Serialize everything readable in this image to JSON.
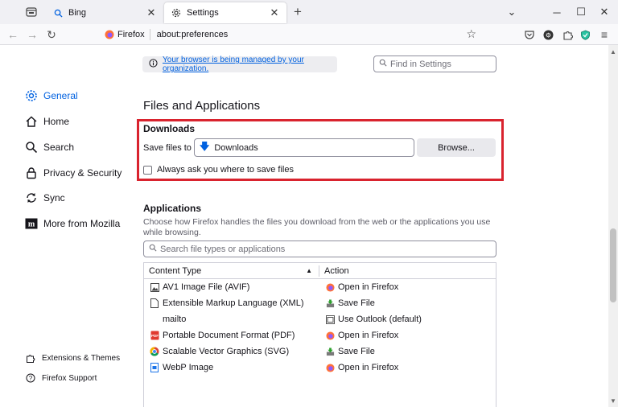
{
  "tabs": [
    {
      "label": "Bing",
      "icon": "search-icon"
    },
    {
      "label": "Settings",
      "icon": "gear-icon",
      "active": true
    }
  ],
  "navbar": {
    "identity_label": "Firefox",
    "url": "about:preferences"
  },
  "sidebar": {
    "items": [
      {
        "label": "General",
        "icon": "gear-icon",
        "active": true
      },
      {
        "label": "Home",
        "icon": "home-icon"
      },
      {
        "label": "Search",
        "icon": "search-icon"
      },
      {
        "label": "Privacy & Security",
        "icon": "lock-icon"
      },
      {
        "label": "Sync",
        "icon": "sync-icon"
      },
      {
        "label": "More from Mozilla",
        "icon": "mozilla-icon"
      }
    ],
    "footer": [
      {
        "label": "Extensions & Themes",
        "icon": "puzzle-icon"
      },
      {
        "label": "Firefox Support",
        "icon": "help-icon"
      }
    ]
  },
  "policy_banner": {
    "text": "Your browser is being managed by your organization."
  },
  "find": {
    "placeholder": "Find in Settings"
  },
  "section_title": "Files and Applications",
  "downloads": {
    "heading": "Downloads",
    "save_label": "Save files to",
    "folder": "Downloads",
    "browse_label": "Browse...",
    "always_ask_label": "Always ask you where to save files",
    "always_ask_checked": false
  },
  "applications": {
    "heading": "Applications",
    "description": "Choose how Firefox handles the files you download from the web or the applications you use while browsing.",
    "search_placeholder": "Search file types or applications",
    "columns": [
      "Content Type",
      "Action"
    ],
    "rows": [
      {
        "type": "AV1 Image File (AVIF)",
        "type_icon": "image-file-icon",
        "action": "Open in Firefox",
        "action_icon": "firefox-icon"
      },
      {
        "type": "Extensible Markup Language (XML)",
        "type_icon": "document-icon",
        "action": "Save File",
        "action_icon": "save-file-icon"
      },
      {
        "type": "mailto",
        "type_icon": "",
        "action": "Use Outlook (default)",
        "action_icon": "outlook-icon"
      },
      {
        "type": "Portable Document Format (PDF)",
        "type_icon": "pdf-icon",
        "action": "Open in Firefox",
        "action_icon": "firefox-icon"
      },
      {
        "type": "Scalable Vector Graphics (SVG)",
        "type_icon": "chrome-icon",
        "action": "Save File",
        "action_icon": "save-file-icon"
      },
      {
        "type": "WebP Image",
        "type_icon": "webp-icon",
        "action": "Open in Firefox",
        "action_icon": "firefox-icon"
      }
    ]
  },
  "colors": {
    "accent": "#0061e0",
    "highlight": "#d9232e"
  }
}
